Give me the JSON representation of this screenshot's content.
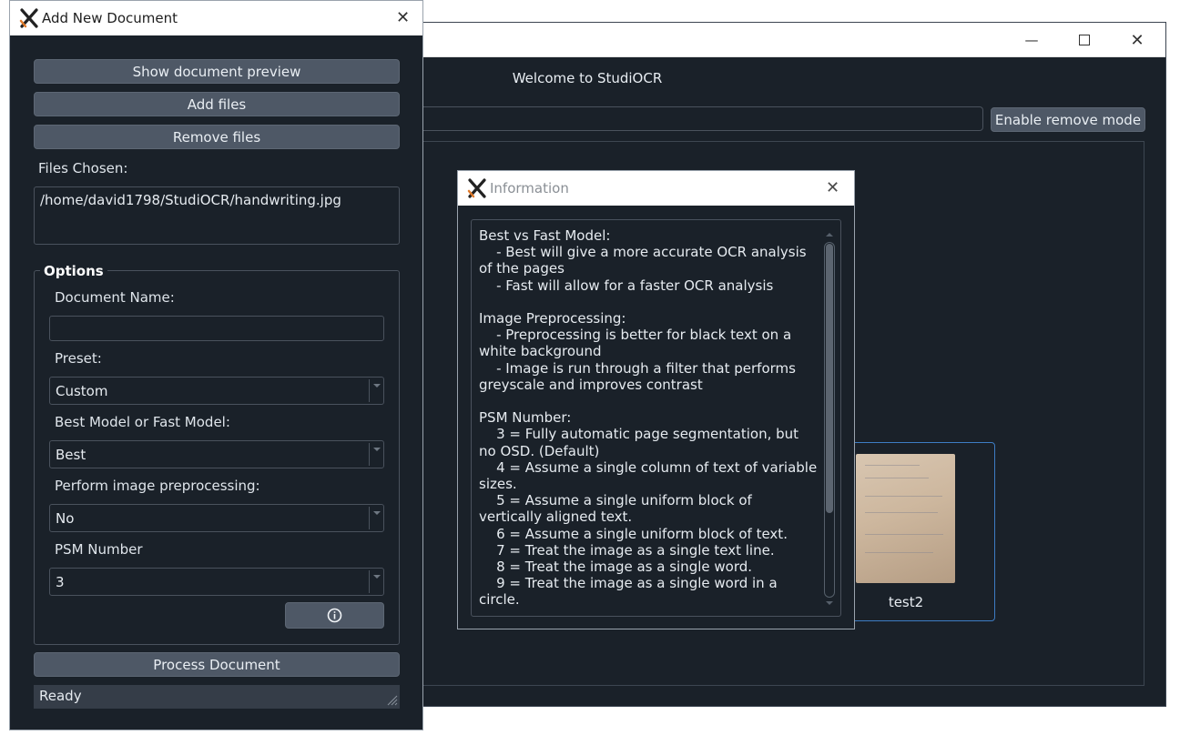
{
  "main_window": {
    "welcome": "Welcome to StudiOCR",
    "remove_mode_label": "Enable remove mode",
    "documents": [
      {
        "name": "test2"
      }
    ]
  },
  "info_dialog": {
    "title": "Information",
    "text": "Best vs Fast Model:\n    - Best will give a more accurate OCR analysis of the pages\n    - Fast will allow for a faster OCR analysis\n\nImage Preprocessing:\n    - Preprocessing is better for black text on a white background\n    - Image is run through a filter that performs greyscale and improves contrast\n\nPSM Number:\n    3 = Fully automatic page segmentation, but no OSD. (Default)\n    4 = Assume a single column of text of variable sizes.\n    5 = Assume a single uniform block of vertically aligned text.\n    6 = Assume a single uniform block of text.\n    7 = Treat the image as a single text line.\n    8 = Treat the image as a single word.\n    9 = Treat the image as a single word in a circle."
  },
  "add_dialog": {
    "title": "Add New Document",
    "preview_button": "Show document preview",
    "add_files_button": "Add files",
    "remove_files_button": "Remove files",
    "files_chosen_label": "Files Chosen:",
    "files": [
      "/home/david1798/StudiOCR/handwriting.jpg"
    ],
    "options": {
      "title": "Options",
      "doc_name_label": "Document Name:",
      "doc_name_value": "",
      "preset_label": "Preset:",
      "preset_value": "Custom",
      "model_label": "Best Model or Fast Model:",
      "model_value": "Best",
      "preprocess_label": "Perform image preprocessing:",
      "preprocess_value": "No",
      "psm_label": "PSM Number",
      "psm_value": "3"
    },
    "process_button": "Process Document",
    "status": "Ready"
  }
}
